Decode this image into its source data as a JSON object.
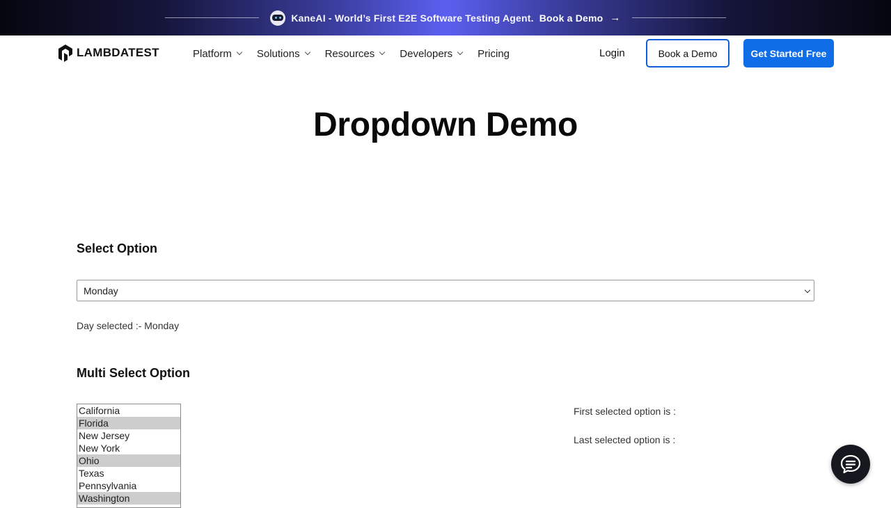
{
  "promo": {
    "text": "KaneAI - World’s First E2E Software Testing Agent.",
    "link": "Book a Demo",
    "arrow": "→"
  },
  "nav": {
    "logo": "LAMBDATEST",
    "menu": [
      {
        "label": "Platform",
        "has_dropdown": true
      },
      {
        "label": "Solutions",
        "has_dropdown": true
      },
      {
        "label": "Resources",
        "has_dropdown": true
      },
      {
        "label": "Developers",
        "has_dropdown": true
      },
      {
        "label": "Pricing",
        "has_dropdown": false
      }
    ],
    "login": "Login",
    "book_demo": "Book a Demo",
    "get_started": "Get Started Free",
    "accent_color": "#0f6de8"
  },
  "main": {
    "title": "Dropdown Demo",
    "select_section": {
      "title": "Select Option",
      "selected_value": "Monday",
      "result_text": "Day selected :- Monday"
    },
    "multi_section": {
      "title": "Multi Select Option",
      "options": [
        {
          "label": "California",
          "selected": false
        },
        {
          "label": "Florida",
          "selected": true
        },
        {
          "label": "New Jersey",
          "selected": false
        },
        {
          "label": "New York",
          "selected": false
        },
        {
          "label": "Ohio",
          "selected": true
        },
        {
          "label": "Texas",
          "selected": false
        },
        {
          "label": "Pennsylvania",
          "selected": false
        },
        {
          "label": "Washington",
          "selected": true
        }
      ],
      "first_selected_text": "First selected option is :",
      "last_selected_text": "Last selected option is :"
    }
  },
  "chat_widget": {
    "icon": "chat-bubble-icon"
  }
}
